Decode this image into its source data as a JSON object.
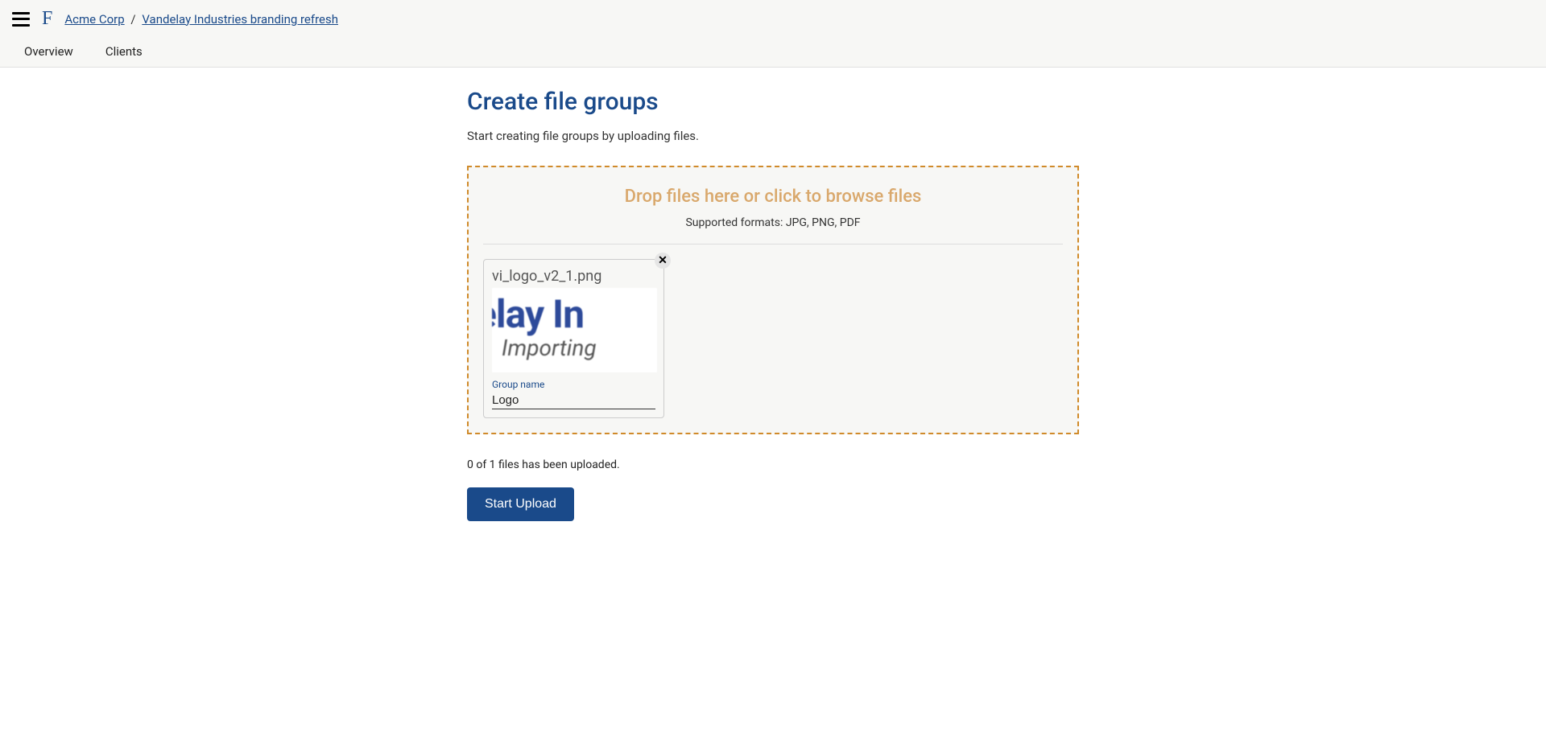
{
  "header": {
    "logo_letter": "F",
    "breadcrumb": {
      "org": "Acme Corp",
      "sep": "/",
      "project": "Vandelay Industries branding refresh"
    },
    "tabs": {
      "overview": "Overview",
      "clients": "Clients"
    }
  },
  "page": {
    "title": "Create file groups",
    "subtitle": "Start creating file groups by uploading files.",
    "dropzone": {
      "heading": "Drop files here or click to browse files",
      "formats": "Supported formats: JPG, PNG, PDF"
    },
    "file": {
      "name": "vi_logo_v2_1.png",
      "thumb_line1": "elay In",
      "thumb_line2": "Importing",
      "group_label": "Group name",
      "group_value": "Logo"
    },
    "status": "0 of 1 files has been uploaded.",
    "start_button": "Start Upload"
  }
}
